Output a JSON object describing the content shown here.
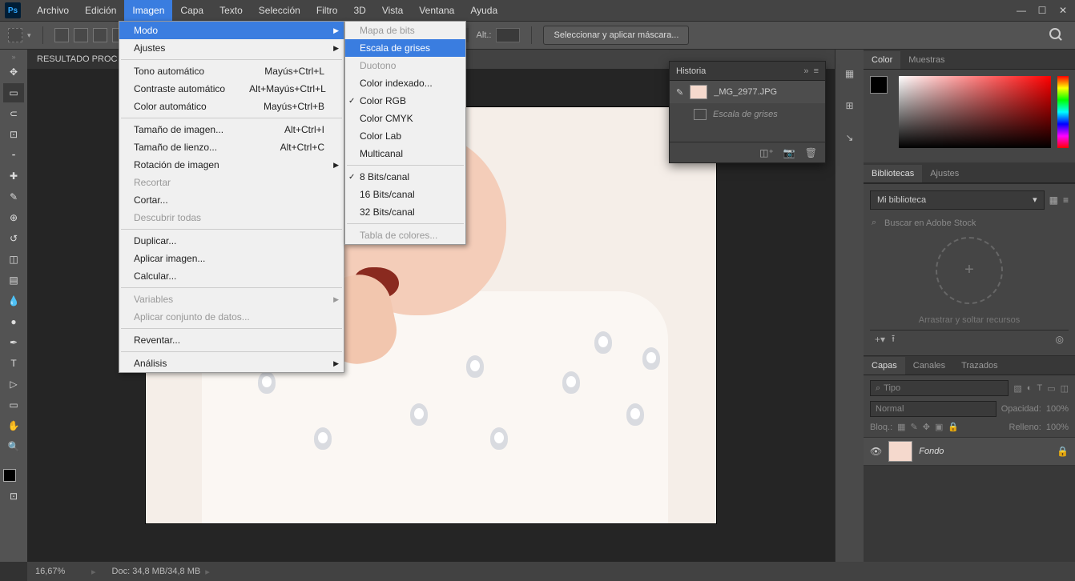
{
  "menubar": {
    "items": [
      "Archivo",
      "Edición",
      "Imagen",
      "Capa",
      "Texto",
      "Selección",
      "Filtro",
      "3D",
      "Vista",
      "Ventana",
      "Ayuda"
    ],
    "active_index": 2
  },
  "optionsbar": {
    "alt_label": "Alt.:",
    "mask_button": "Seleccionar y aplicar máscara..."
  },
  "doc_tab": {
    "title": "RESULTADO PROC"
  },
  "statusbar": {
    "zoom": "16,67%",
    "docinfo": "Doc: 34,8 MB/34,8 MB"
  },
  "menus": {
    "imagen": {
      "groups": [
        [
          {
            "label": "Modo",
            "arrow": true,
            "hl": true
          },
          {
            "label": "Ajustes",
            "arrow": true
          }
        ],
        [
          {
            "label": "Tono automático",
            "shortcut": "Mayús+Ctrl+L"
          },
          {
            "label": "Contraste automático",
            "shortcut": "Alt+Mayús+Ctrl+L"
          },
          {
            "label": "Color automático",
            "shortcut": "Mayús+Ctrl+B"
          }
        ],
        [
          {
            "label": "Tamaño de imagen...",
            "shortcut": "Alt+Ctrl+I"
          },
          {
            "label": "Tamaño de lienzo...",
            "shortcut": "Alt+Ctrl+C"
          },
          {
            "label": "Rotación de imagen",
            "arrow": true
          },
          {
            "label": "Recortar",
            "disabled": true
          },
          {
            "label": "Cortar..."
          },
          {
            "label": "Descubrir todas",
            "disabled": true
          }
        ],
        [
          {
            "label": "Duplicar..."
          },
          {
            "label": "Aplicar imagen..."
          },
          {
            "label": "Calcular..."
          }
        ],
        [
          {
            "label": "Variables",
            "arrow": true,
            "disabled": true
          },
          {
            "label": "Aplicar conjunto de datos...",
            "disabled": true
          }
        ],
        [
          {
            "label": "Reventar..."
          }
        ],
        [
          {
            "label": "Análisis",
            "arrow": true
          }
        ]
      ]
    },
    "modo": {
      "groups": [
        [
          {
            "label": "Mapa de bits",
            "disabled": true
          },
          {
            "label": "Escala de grises",
            "hl": true
          },
          {
            "label": "Duotono",
            "disabled": true
          },
          {
            "label": "Color indexado..."
          },
          {
            "label": "Color RGB",
            "check": true
          },
          {
            "label": "Color CMYK"
          },
          {
            "label": "Color Lab"
          },
          {
            "label": "Multicanal"
          }
        ],
        [
          {
            "label": "8 Bits/canal",
            "check": true
          },
          {
            "label": "16 Bits/canal"
          },
          {
            "label": "32 Bits/canal"
          }
        ],
        [
          {
            "label": "Tabla de colores...",
            "disabled": true
          }
        ]
      ]
    }
  },
  "history": {
    "title": "Historia",
    "snapshot": "_MG_2977.JPG",
    "step": "Escala de grises"
  },
  "panels": {
    "color": {
      "tabs": [
        "Color",
        "Muestras"
      ],
      "active": 0
    },
    "libraries": {
      "tabs": [
        "Bibliotecas",
        "Ajustes"
      ],
      "active": 0,
      "select": "Mi biblioteca",
      "search_placeholder": "Buscar en Adobe Stock",
      "dropzone": "Arrastrar y soltar recursos"
    },
    "layers": {
      "tabs": [
        "Capas",
        "Canales",
        "Trazados"
      ],
      "active": 0,
      "kind_label": "Tipo",
      "blend": "Normal",
      "opacity_label": "Opacidad:",
      "opacity_value": "100%",
      "lock_label": "Bloq.:",
      "fill_label": "Relleno:",
      "fill_value": "100%",
      "layer_name": "Fondo"
    }
  },
  "tools": [
    "move",
    "marquee",
    "lasso",
    "crop",
    "eyedropper",
    "healing",
    "brush",
    "clone",
    "history-brush",
    "eraser",
    "gradient",
    "blur",
    "dodge",
    "pen",
    "type",
    "path-select",
    "rectangle",
    "hand",
    "zoom"
  ]
}
